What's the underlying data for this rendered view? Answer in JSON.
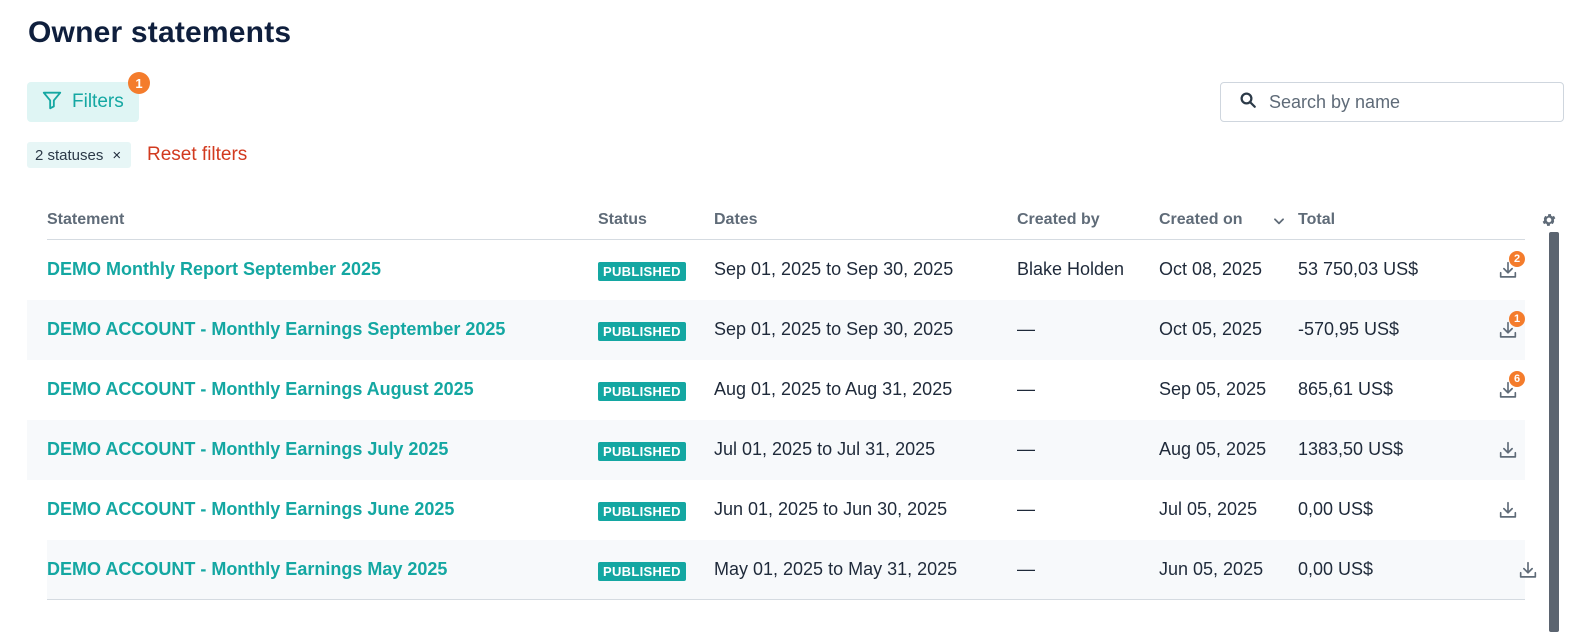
{
  "page": {
    "title": "Owner statements"
  },
  "toolbar": {
    "filters_label": "Filters",
    "filters_count": "1"
  },
  "search": {
    "placeholder": "Search by name",
    "value": ""
  },
  "active_filters": {
    "chip_label": "2 statuses",
    "chip_close": "×",
    "reset_label": "Reset filters"
  },
  "table": {
    "columns": {
      "statement": "Statement",
      "status": "Status",
      "dates": "Dates",
      "created_by": "Created by",
      "created_on": "Created on",
      "total": "Total"
    },
    "rows": [
      {
        "name": "DEMO Monthly Report September 2025",
        "status": "PUBLISHED",
        "dates": "Sep 01, 2025 to Sep 30, 2025",
        "created_by": "Blake Holden",
        "created_on": "Oct 08, 2025",
        "total": "53 750,03 US$",
        "downloads": "2"
      },
      {
        "name": "DEMO ACCOUNT - Monthly Earnings September 2025",
        "status": "PUBLISHED",
        "dates": "Sep 01, 2025 to Sep 30, 2025",
        "created_by": "—",
        "created_on": "Oct 05, 2025",
        "total": "-570,95 US$",
        "downloads": "1"
      },
      {
        "name": "DEMO ACCOUNT - Monthly Earnings August 2025",
        "status": "PUBLISHED",
        "dates": "Aug 01, 2025 to Aug 31, 2025",
        "created_by": "—",
        "created_on": "Sep 05, 2025",
        "total": "865,61 US$",
        "downloads": "6"
      },
      {
        "name": "DEMO ACCOUNT - Monthly Earnings July 2025",
        "status": "PUBLISHED",
        "dates": "Jul 01, 2025 to Jul 31, 2025",
        "created_by": "—",
        "created_on": "Aug 05, 2025",
        "total": "1383,50 US$",
        "downloads": ""
      },
      {
        "name": "DEMO ACCOUNT - Monthly Earnings June 2025",
        "status": "PUBLISHED",
        "dates": "Jun 01, 2025 to Jun 30, 2025",
        "created_by": "—",
        "created_on": "Jul 05, 2025",
        "total": "0,00 US$",
        "downloads": ""
      },
      {
        "name": "DEMO ACCOUNT - Monthly Earnings May 2025",
        "status": "PUBLISHED",
        "dates": "May 01, 2025 to May 31, 2025",
        "created_by": "—",
        "created_on": "Jun 05, 2025",
        "total": "0,00 US$",
        "downloads": ""
      }
    ]
  },
  "icons": {
    "filter": "filter-icon",
    "search": "search-icon",
    "sort": "chevron-down-icon",
    "settings": "gear-icon",
    "download": "download-icon"
  },
  "colors": {
    "accent": "#14a7a2",
    "badge_orange": "#f47c2c",
    "reset_red": "#d23a1f",
    "title": "#0f1f3d"
  }
}
